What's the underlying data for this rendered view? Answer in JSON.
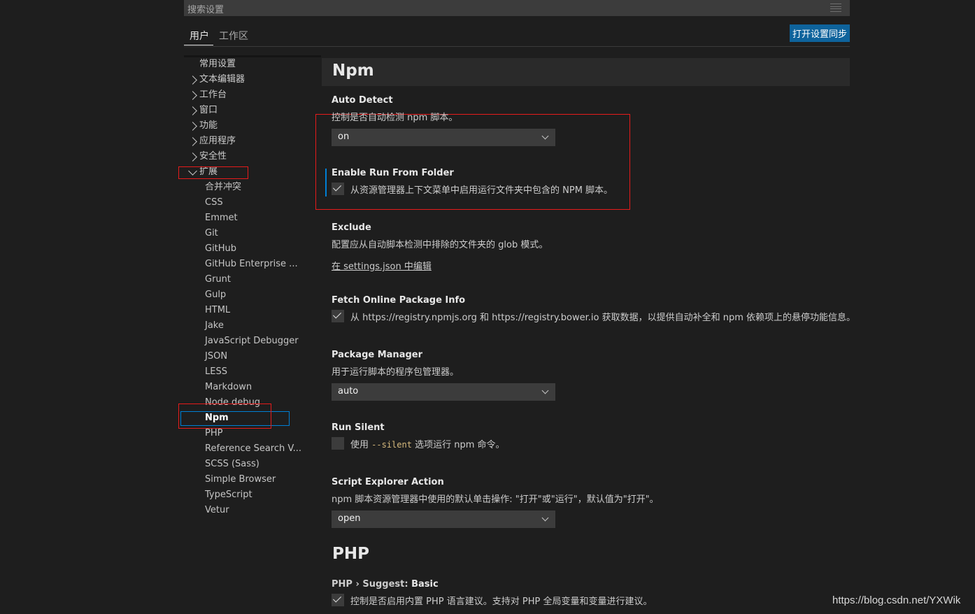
{
  "search": {
    "placeholder": "搜索设置"
  },
  "tabs": [
    {
      "label": "用户"
    },
    {
      "label": "工作区"
    }
  ],
  "sync_button": "打开设置同步",
  "toc": {
    "top": [
      "常用设置",
      "文本编辑器",
      "工作台",
      "窗口",
      "功能",
      "应用程序",
      "安全性",
      "扩展"
    ],
    "extensions": [
      "合并冲突",
      "CSS",
      "Emmet",
      "Git",
      "GitHub",
      "GitHub Enterprise ...",
      "Grunt",
      "Gulp",
      "HTML",
      "Jake",
      "JavaScript Debugger",
      "JSON",
      "LESS",
      "Markdown",
      "Node debug",
      "Npm",
      "PHP",
      "Reference Search V...",
      "SCSS (Sass)",
      "Simple Browser",
      "TypeScript",
      "Vetur"
    ],
    "selected": "Npm"
  },
  "npm": {
    "title": "Npm",
    "auto_detect": {
      "title": "Auto Detect",
      "desc": "控制是否自动检测 npm 脚本。",
      "value": "on"
    },
    "enable_run_from_folder": {
      "title": "Enable Run From Folder",
      "desc": "从资源管理器上下文菜单中启用运行文件夹中包含的 NPM 脚本。",
      "checked": true
    },
    "exclude": {
      "title": "Exclude",
      "desc": "配置应从自动脚本检测中排除的文件夹的 glob 模式。",
      "link": "在 settings.json 中编辑"
    },
    "fetch_online": {
      "title": "Fetch Online Package Info",
      "desc": "从 https://registry.npmjs.org 和 https://registry.bower.io 获取数据，以提供自动补全和 npm 依赖项上的悬停功能信息。",
      "checked": true
    },
    "package_manager": {
      "title": "Package Manager",
      "desc": "用于运行脚本的程序包管理器。",
      "value": "auto"
    },
    "run_silent": {
      "title": "Run Silent",
      "desc_pre": "使用 ",
      "desc_code": "--silent",
      "desc_post": " 选项运行 npm 命令。",
      "checked": false
    },
    "script_explorer": {
      "title": "Script Explorer Action",
      "desc": "npm 脚本资源管理器中使用的默认单击操作: \"打开\"或\"运行\"，默认值为\"打开\"。",
      "value": "open"
    }
  },
  "php": {
    "title": "PHP",
    "suggest_basic": {
      "category": "PHP › Suggest: ",
      "title": "Basic",
      "desc": "控制是否启用内置 PHP 语言建议。支持对 PHP 全局变量和变量进行建议。",
      "checked": true
    }
  },
  "watermark": "https://blog.csdn.net/YXWik",
  "colors": {
    "accent": "#0e639c",
    "focus": "#007fd4",
    "highlight": "#e61b1b",
    "background": "#1e1e1e"
  }
}
